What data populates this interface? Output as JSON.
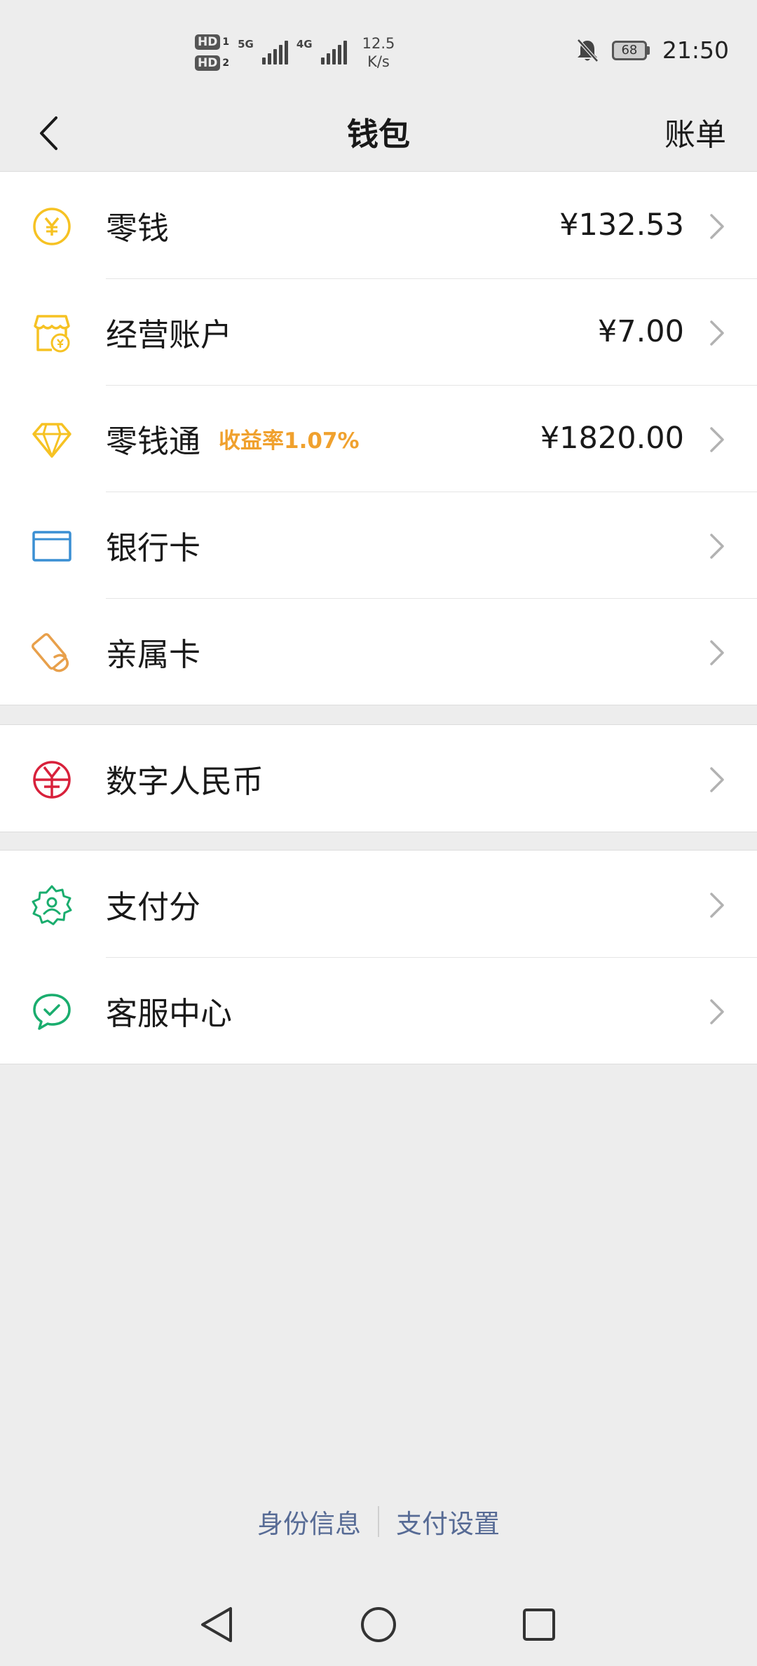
{
  "status_bar": {
    "sim1_label": "HD",
    "sim1_num": "1",
    "sim2_label": "HD",
    "sim2_num": "2",
    "net1": "5G",
    "net2": "4G",
    "speed_value": "12.5",
    "speed_unit": "K/s",
    "battery": "68",
    "time": "21:50"
  },
  "navbar": {
    "title": "钱包",
    "right_action": "账单"
  },
  "wallet_items": [
    {
      "label": "零钱",
      "value": "¥132.53",
      "icon": "coin-yuan-icon",
      "color": "#f6c223"
    },
    {
      "label": "经营账户",
      "value": "¥7.00",
      "icon": "shop-yuan-icon",
      "color": "#f6c223"
    },
    {
      "label": "零钱通",
      "tag": "收益率1.07%",
      "value": "¥1820.00",
      "icon": "diamond-icon",
      "color": "#f6c223"
    },
    {
      "label": "银行卡",
      "icon": "bank-card-icon",
      "color": "#3a8fd3"
    },
    {
      "label": "亲属卡",
      "icon": "family-card-icon",
      "color": "#e8a04b"
    }
  ],
  "digital_items": [
    {
      "label": "数字人民币",
      "icon": "digital-rmb-icon",
      "color": "#d8213b"
    }
  ],
  "service_items": [
    {
      "label": "支付分",
      "icon": "pay-score-icon",
      "color": "#1aad6e"
    },
    {
      "label": "客服中心",
      "icon": "customer-service-icon",
      "color": "#1aad6e"
    }
  ],
  "footer": {
    "identity": "身份信息",
    "settings": "支付设置"
  },
  "colors": {
    "background": "#ededed",
    "link": "#576b95",
    "rate": "#f0a12e"
  }
}
